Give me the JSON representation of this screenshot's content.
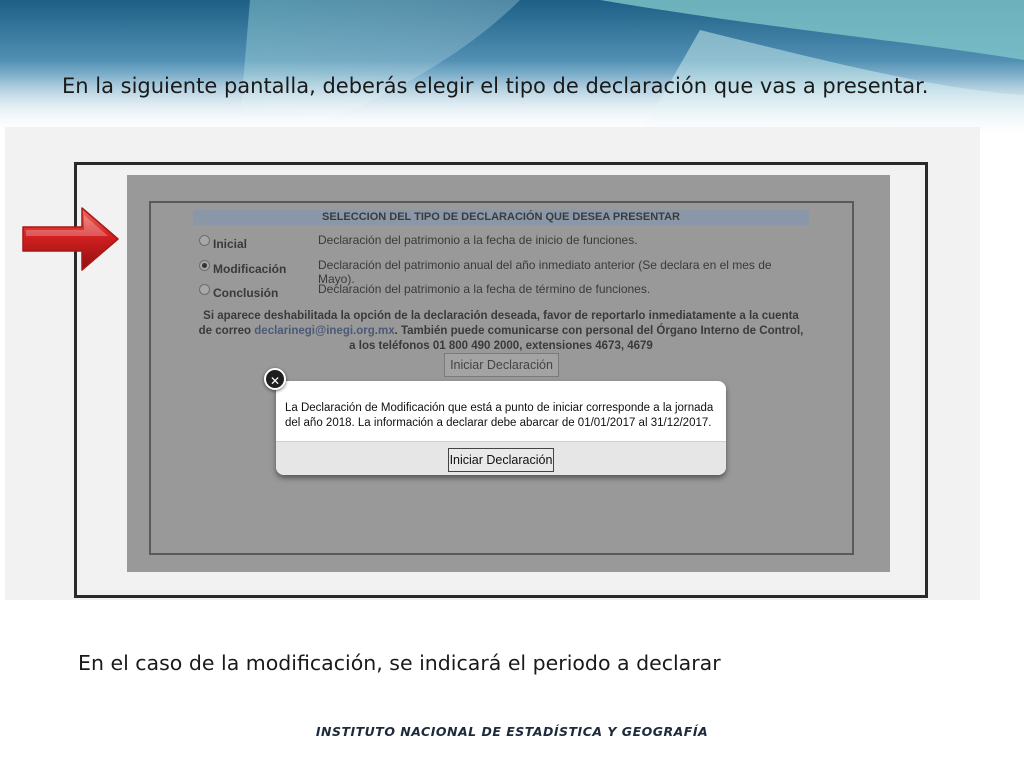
{
  "slide": {
    "intro": "En la siguiente pantalla, deberás elegir el tipo de declaración que vas a presentar.",
    "caption": "En el caso de la modificación, se indicará el periodo a declarar",
    "footer": "INSTITUTO NACIONAL  DE ESTADÍSTICA Y GEOGRAFÍA"
  },
  "declaration_form": {
    "header": "SELECCION DEL TIPO DE DECLARACIÓN QUE DESEA PRESENTAR",
    "options": [
      {
        "label": "Inicial",
        "description": "Declaración del patrimonio a la fecha de inicio de funciones.",
        "selected": false
      },
      {
        "label": "Modificación",
        "description": "Declaración del patrimonio anual del año inmediato anterior (Se declara en el mes de Mayo).",
        "selected": true
      },
      {
        "label": "Conclusión",
        "description": "Declaración del patrimonio a la fecha de término de funciones.",
        "selected": false
      }
    ],
    "notice_before": "Si aparece deshabilitada la opción de la declaración deseada, favor de reportarlo inmediatamente a la cuenta de correo",
    "notice_email": "declarinegi@inegi.org.mx",
    "notice_after": ". También puede comunicarse con personal del Órgano Interno de Control, a los teléfonos 01 800 490 2000, extensiones 4673, 4679",
    "start_button": "Iniciar Declaración"
  },
  "modal": {
    "message": "La Declaración de Modificación que está a punto de iniciar corresponde a la jornada del año 2018. La información a declarar debe abarcar de 01/01/2017 al 31/12/2017.",
    "start_button": "Iniciar Declaración",
    "close_icon": "close-icon"
  },
  "colors": {
    "overlay": "#999999",
    "arrow": "#d42020"
  }
}
